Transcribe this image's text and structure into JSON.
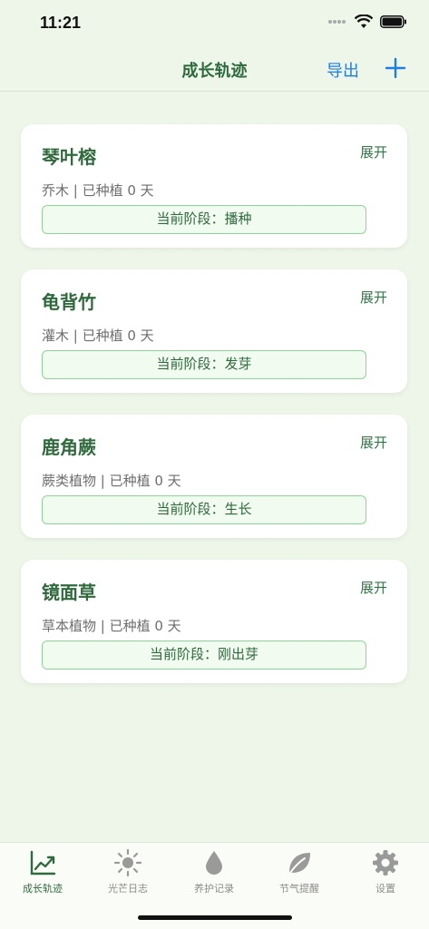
{
  "status_bar": {
    "time": "11:21"
  },
  "nav": {
    "title": "成长轨迹",
    "export_label": "导出",
    "add_icon": "plus-icon"
  },
  "plants": [
    {
      "name": "琴叶榕",
      "expand_label": "展开",
      "meta": "乔木 | 已种植 0 天",
      "stage": "当前阶段：播种"
    },
    {
      "name": "龟背竹",
      "expand_label": "展开",
      "meta": "灌木 | 已种植 0 天",
      "stage": "当前阶段：发芽"
    },
    {
      "name": "鹿角蕨",
      "expand_label": "展开",
      "meta": "蕨类植物 | 已种植 0 天",
      "stage": "当前阶段：生长"
    },
    {
      "name": "镜面草",
      "expand_label": "展开",
      "meta": "草本植物 | 已种植 0 天",
      "stage": "当前阶段：刚出芽"
    }
  ],
  "tabs": [
    {
      "label": "成长轨迹",
      "icon": "chart-icon",
      "active": true
    },
    {
      "label": "光芒日志",
      "icon": "sun-icon",
      "active": false
    },
    {
      "label": "养护记录",
      "icon": "drop-icon",
      "active": false
    },
    {
      "label": "节气提醒",
      "icon": "leaf-icon",
      "active": false
    },
    {
      "label": "设置",
      "icon": "gear-icon",
      "active": false
    }
  ],
  "colors": {
    "accent_green": "#2f6a3d",
    "link_blue": "#1f7ee6",
    "background": "#eef6ea"
  }
}
